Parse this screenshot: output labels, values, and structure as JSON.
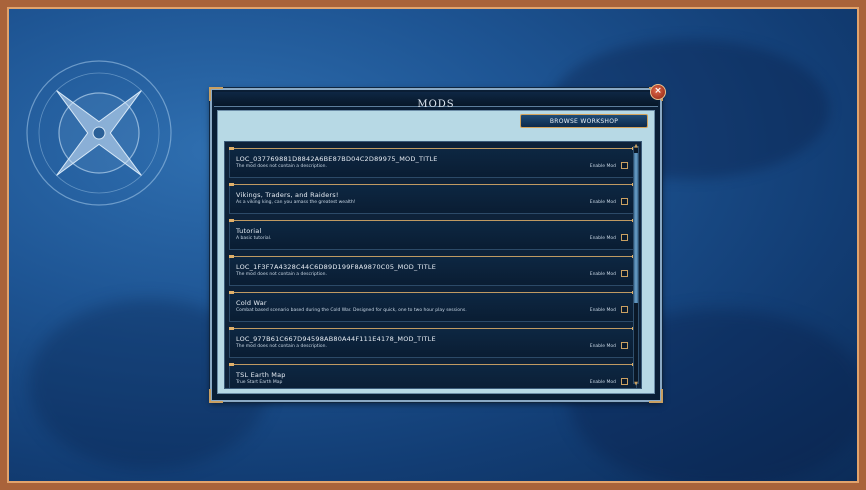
{
  "dialog": {
    "title": "MODS",
    "close_label": "×",
    "browse_label": "BROWSE WORKSHOP"
  },
  "mods": [
    {
      "name": "LOC_037769881D8842A6BE87BD04C2D89975_MOD_TITLE",
      "desc": "The mod does not contain a description.",
      "enable": "Enable Mod"
    },
    {
      "name": "Vikings, Traders, and Raiders!",
      "desc": "As a viking king, can you amass the greatest wealth!",
      "enable": "Enable Mod"
    },
    {
      "name": "Tutorial",
      "desc": "A basic tutorial.",
      "enable": "Enable Mod"
    },
    {
      "name": "LOC_1F3F7A4328C44C6D89D199F8A9870C05_MOD_TITLE",
      "desc": "The mod does not contain a description.",
      "enable": "Enable Mod"
    },
    {
      "name": "Cold War",
      "desc": "Combat based scenario based during the Cold War. Designed for quick, one to two hour play sessions.",
      "enable": "Enable Mod"
    },
    {
      "name": "LOC_977B61C667D94598AB80A44F111E4178_MOD_TITLE",
      "desc": "The mod does not contain a description.",
      "enable": "Enable Mod"
    },
    {
      "name": "TSL Earth Map",
      "desc": "True Start Earth Map",
      "enable": "Enable Mod"
    }
  ]
}
